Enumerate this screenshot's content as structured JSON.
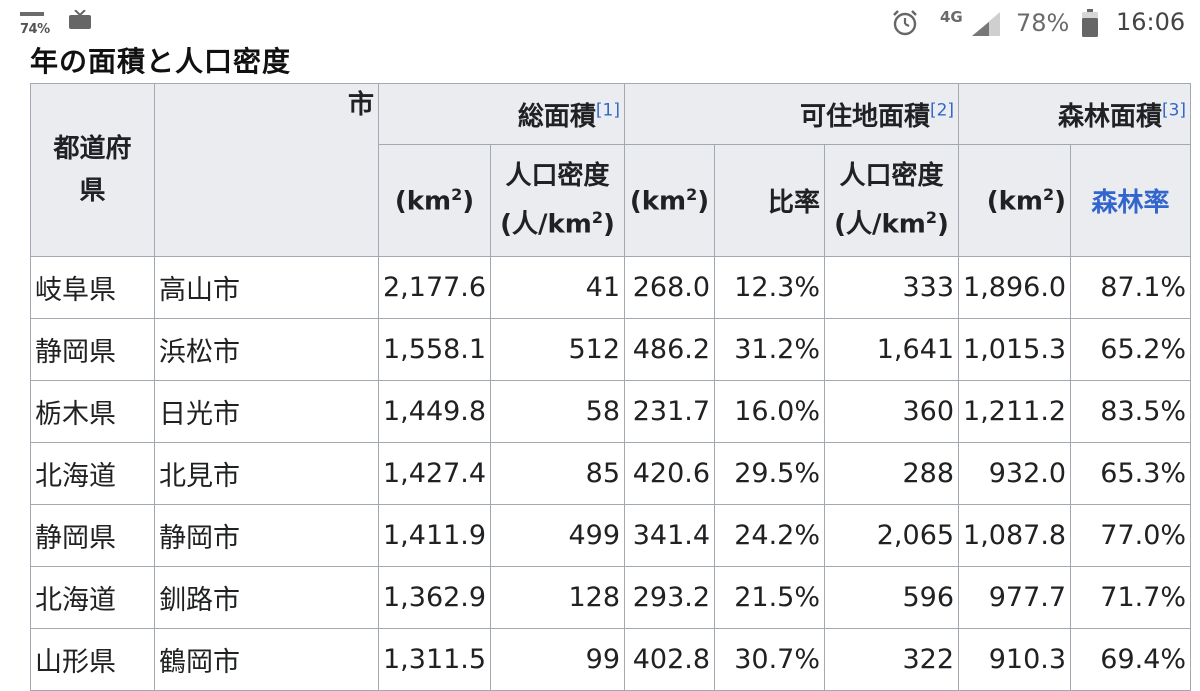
{
  "status_bar": {
    "battery_small": "74%",
    "network": "4G",
    "battery_percent": "78%",
    "time": "16:06",
    "icons": [
      "battery-icon",
      "tv-icon",
      "alarm-icon",
      "signal-icon",
      "battery-icon"
    ]
  },
  "heading": "年の面積と人口密度",
  "table": {
    "head": {
      "prefecture": "都道府県",
      "city": "市",
      "total_area": "総面積",
      "total_area_ref": "[1]",
      "habitable_area": "可住地面積",
      "habitable_area_ref": "[2]",
      "forest_area": "森林面積",
      "forest_area_ref": "[3]",
      "km2_open": "(km",
      "km2_sup": "2",
      "km2_close": ")",
      "pop_density": "人口密度",
      "per_km2_open": "(人/km",
      "per_km2_close": ")",
      "ratio": "比率",
      "forest_ratio": "森林率"
    },
    "rows": [
      {
        "pref": "岐阜県",
        "city": "高山市",
        "total": "2,177.6",
        "dens1": "41",
        "hab": "268.0",
        "ratio": "12.3%",
        "dens2": "333",
        "forest": "1,896.0",
        "frate": "87.1%"
      },
      {
        "pref": "静岡県",
        "city": "浜松市",
        "total": "1,558.1",
        "dens1": "512",
        "hab": "486.2",
        "ratio": "31.2%",
        "dens2": "1,641",
        "forest": "1,015.3",
        "frate": "65.2%"
      },
      {
        "pref": "栃木県",
        "city": "日光市",
        "total": "1,449.8",
        "dens1": "58",
        "hab": "231.7",
        "ratio": "16.0%",
        "dens2": "360",
        "forest": "1,211.2",
        "frate": "83.5%"
      },
      {
        "pref": "北海道",
        "city": "北見市",
        "total": "1,427.4",
        "dens1": "85",
        "hab": "420.6",
        "ratio": "29.5%",
        "dens2": "288",
        "forest": "932.0",
        "frate": "65.3%"
      },
      {
        "pref": "静岡県",
        "city": "静岡市",
        "total": "1,411.9",
        "dens1": "499",
        "hab": "341.4",
        "ratio": "24.2%",
        "dens2": "2,065",
        "forest": "1,087.8",
        "frate": "77.0%"
      },
      {
        "pref": "北海道",
        "city": "釧路市",
        "total": "1,362.9",
        "dens1": "128",
        "hab": "293.2",
        "ratio": "21.5%",
        "dens2": "596",
        "forest": "977.7",
        "frate": "71.7%"
      },
      {
        "pref": "山形県",
        "city": "鶴岡市",
        "total": "1,311.5",
        "dens1": "99",
        "hab": "402.8",
        "ratio": "30.7%",
        "dens2": "322",
        "forest": "910.3",
        "frate": "69.4%"
      }
    ]
  },
  "colors": {
    "link": "#3366cc",
    "header_bg": "#eaecf0",
    "border": "#a2a9b1"
  }
}
